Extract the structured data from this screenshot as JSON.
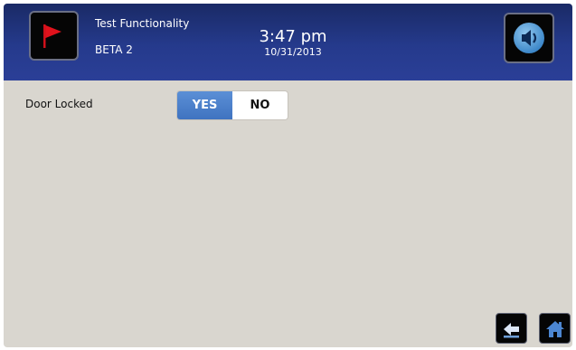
{
  "header": {
    "title": "Test Functionality",
    "subtitle": "BETA 2",
    "time": "3:47 pm",
    "date": "10/31/2013",
    "flag_icon": "flag-icon",
    "sound_icon": "speaker-icon"
  },
  "main": {
    "door_locked_label": "Door Locked",
    "toggle": {
      "yes_label": "YES",
      "no_label": "NO",
      "selected": "YES"
    }
  },
  "footer": {
    "back_icon": "back-arrow-icon",
    "home_icon": "home-icon"
  },
  "colors": {
    "header_blue": "#253a8c",
    "accent_blue": "#4a7fcb",
    "flag_red": "#d0101a",
    "background": "#d9d6cf"
  }
}
